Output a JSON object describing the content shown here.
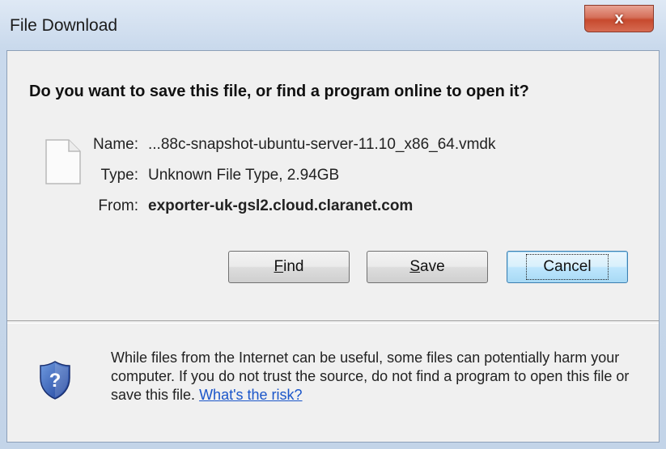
{
  "window": {
    "title": "File Download",
    "close_glyph": "x"
  },
  "dialog": {
    "question": "Do you want to save this file, or find a program online to open it?",
    "file_icon": "blank-file-icon",
    "fields": {
      "name_label": "Name:",
      "name_value": "...88c-snapshot-ubuntu-server-11.10_x86_64.vmdk",
      "type_label": "Type:",
      "type_value": "Unknown File Type, 2.94GB",
      "from_label": "From:",
      "from_value": "exporter-uk-gsl2.cloud.claranet.com"
    },
    "buttons": {
      "find_mnemonic": "F",
      "find_rest": "ind",
      "save_mnemonic": "S",
      "save_rest": "ave",
      "cancel_label": "Cancel"
    },
    "warning": {
      "icon": "security-shield-question-icon",
      "text": "While files from the Internet can be useful, some files can potentially harm your computer. If you do not trust the source, do not find a program to open this file or save this file.",
      "link": "What's the risk?"
    }
  },
  "colors": {
    "link": "#1a55c9",
    "close_button": "#c74a2e",
    "default_button_border": "#3c7fb1"
  }
}
